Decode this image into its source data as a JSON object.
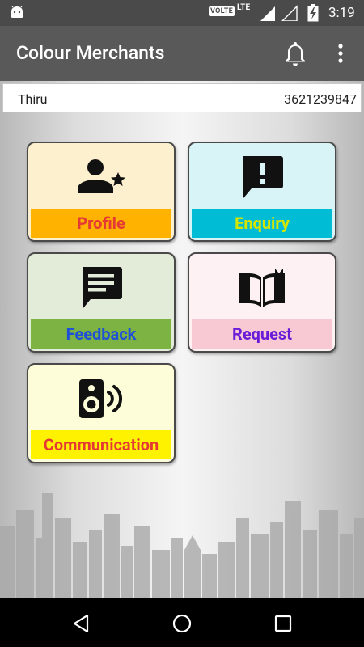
{
  "status_bar": {
    "volte": "VOLTE",
    "network": "LTE",
    "time": "3:19"
  },
  "app_bar": {
    "title": "Colour Merchants",
    "icons": [
      "bell-icon",
      "more-vert-icon"
    ]
  },
  "user": {
    "name": "Thiru",
    "phone": "3621239847"
  },
  "tiles": [
    {
      "label": "Profile",
      "icon": "person-star-icon",
      "bg": "#fdf0cf",
      "band": "#ffb300",
      "text": "#e53935"
    },
    {
      "label": "Enquiry",
      "icon": "feedback-alert-icon",
      "bg": "#d8f4f7",
      "band": "#00bcd4",
      "text": "#d4e600"
    },
    {
      "label": "Feedback",
      "icon": "message-icon",
      "bg": "#e3ecd9",
      "band": "#7cb342",
      "text": "#1e4fd8"
    },
    {
      "label": "Request",
      "icon": "open-book-icon",
      "bg": "#fdf1f3",
      "band": "#f8c8d3",
      "text": "#6a1bd8"
    },
    {
      "label": "Communication",
      "icon": "speaker-icon",
      "bg": "#fdfdd9",
      "band": "#fff200",
      "text": "#e53935"
    }
  ],
  "colors": {
    "status_bar": "#4a4a4a",
    "app_bar": "#595959",
    "nav_bar": "#000000"
  }
}
